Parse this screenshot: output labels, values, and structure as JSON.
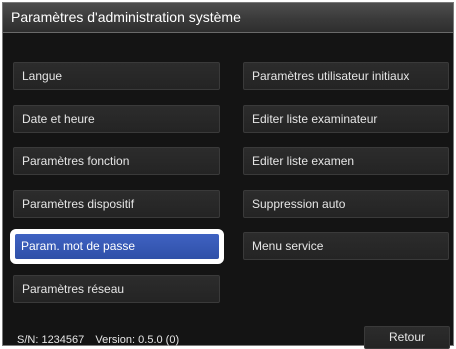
{
  "window": {
    "title": "Paramètres d'administration système"
  },
  "menu": {
    "left": [
      {
        "label": "Langue"
      },
      {
        "label": "Date et heure"
      },
      {
        "label": "Paramètres fonction"
      },
      {
        "label": "Paramètres dispositif"
      },
      {
        "label": "Param. mot de passe",
        "selected": true
      },
      {
        "label": "Paramètres réseau"
      }
    ],
    "right": [
      {
        "label": "Paramètres utilisateur initiaux"
      },
      {
        "label": "Editer liste examinateur"
      },
      {
        "label": "Editer liste examen"
      },
      {
        "label": "Suppression auto"
      },
      {
        "label": "Menu service"
      }
    ]
  },
  "footer": {
    "serial": "S/N: 1234567",
    "version": "Version: 0.5.0 (0)",
    "back_label": "Retour"
  },
  "colors": {
    "background": "#141414",
    "selected_button": "#3f62c2",
    "selected_outline": "#ffffff",
    "text": "#e6e6e6"
  }
}
